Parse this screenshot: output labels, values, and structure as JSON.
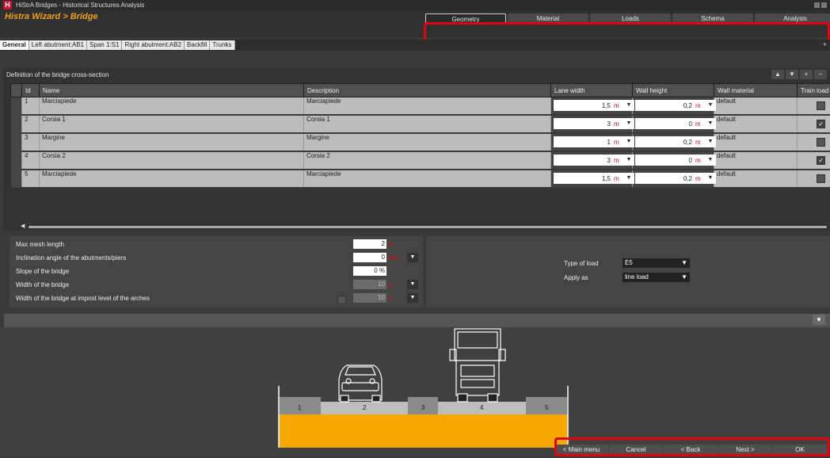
{
  "window": {
    "title": "HiStrA Bridges - Historical Structures Analysis",
    "logo_letter": "H"
  },
  "wizard_title": "Histra Wizard > Bridge",
  "nav_tabs": [
    {
      "label": "Geometry",
      "active": true
    },
    {
      "label": "Material"
    },
    {
      "label": "Loads"
    },
    {
      "label": "Schema"
    },
    {
      "label": "Analysis"
    }
  ],
  "sub_tabs": [
    "General",
    "Left abutment:AB1",
    "Span 1:S1",
    "Right abutment:AB2",
    "Backfill",
    "Trunks"
  ],
  "grid": {
    "title": "Definition of the bridge cross-section",
    "columns": [
      "Id",
      "Name",
      "Description",
      "Lane width",
      "Wall height",
      "Wall material",
      "Train load"
    ],
    "unit": "m",
    "rows": [
      {
        "id": "1",
        "name": "Marciapiede",
        "description": "Marciapiede",
        "lane_width": "1,5",
        "wall_height": "0,2",
        "wall_material": "default",
        "train_load": false
      },
      {
        "id": "2",
        "name": "Corsia 1",
        "description": "Corsia 1",
        "lane_width": "3",
        "wall_height": "0",
        "wall_material": "default",
        "train_load": true
      },
      {
        "id": "3",
        "name": "Margine",
        "description": "Margine",
        "lane_width": "1",
        "wall_height": "0,2",
        "wall_material": "default",
        "train_load": false
      },
      {
        "id": "4",
        "name": "Corsia 2",
        "description": "Corsia 2",
        "lane_width": "3",
        "wall_height": "0",
        "wall_material": "default",
        "train_load": true
      },
      {
        "id": "5",
        "name": "Marciapiede",
        "description": "Marciapiede",
        "lane_width": "1,5",
        "wall_height": "0,2",
        "wall_material": "default",
        "train_load": false
      }
    ]
  },
  "params": {
    "max_mesh_label": "Max mesh length",
    "max_mesh_value": "2",
    "max_mesh_unit": "m",
    "inclination_label": "Inclination angle of the abutments/piers",
    "inclination_value": "0",
    "inclination_unit": "deg",
    "slope_label": "Slope of the bridge",
    "slope_value": "0 %",
    "width_label": "Width of the bridge",
    "width_value": "10",
    "width_unit": "m",
    "impost_label": "Width of the bridge at impost level of the arches",
    "impost_value": "10",
    "impost_unit": "m"
  },
  "loads": {
    "type_label": "Type of load",
    "type_value": "E5",
    "apply_label": "Apply as",
    "apply_value": "line load"
  },
  "drawing": {
    "lane_numbers": [
      "1",
      "2",
      "3",
      "4",
      "5"
    ],
    "deck_color": "#f5a800"
  },
  "bottom_buttons": [
    "< Main menu",
    "Cancel",
    "< Back",
    "Next >",
    "OK"
  ]
}
